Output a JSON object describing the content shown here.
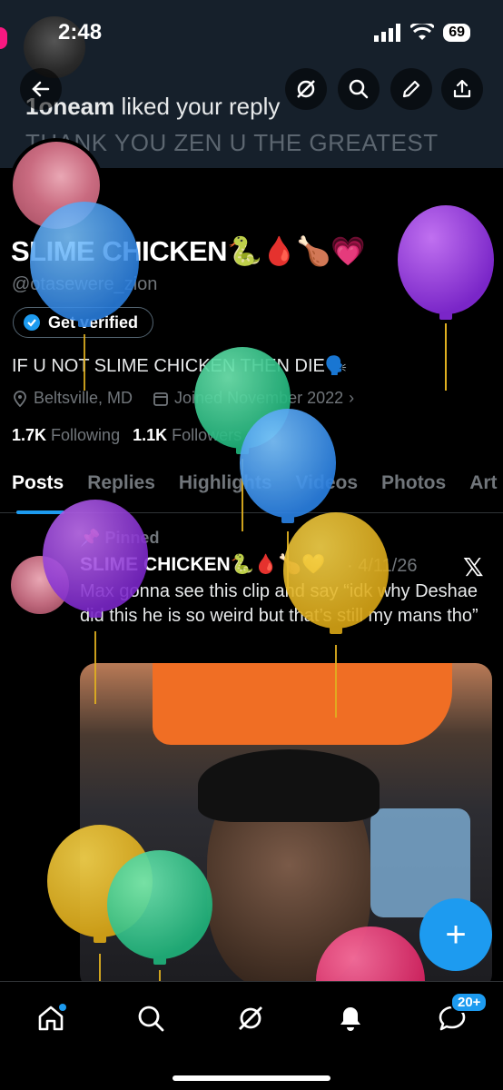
{
  "status_bar": {
    "time": "2:48",
    "battery": "69"
  },
  "notification": {
    "user": "1oneam",
    "action": " liked your reply",
    "preview": "THANK YOU ZEN U THE GREATEST"
  },
  "profile": {
    "display_name": "SLIME CHICKEN🐍🩸🍗💗",
    "handle": "@otasewere_zion",
    "verify_label": "Get verified",
    "bio": "IF U NOT SLIME CHICKEN THEN DIE🗣️",
    "location": "Beltsville, MD",
    "joined": "Joined November 2022",
    "following_count": "1.7K",
    "following_label": "Following",
    "followers_count": "1.1K",
    "followers_label": "Followers"
  },
  "tabs": [
    "Posts",
    "Replies",
    "Highlights",
    "Videos",
    "Photos",
    "Art"
  ],
  "post": {
    "pinned_label": "Pinned",
    "author": "SLIME CHICKEN🐍🩸🍗💛",
    "date": "· 4/11/26",
    "text": "Max gonna see this clip and say “idk why Deshae did this he is so weird but that’s still my mans tho”"
  },
  "nav": {
    "messages_badge": "20+"
  },
  "colors": {
    "accent": "#1d9bf0",
    "background": "#000000",
    "banner": "#16202b"
  }
}
